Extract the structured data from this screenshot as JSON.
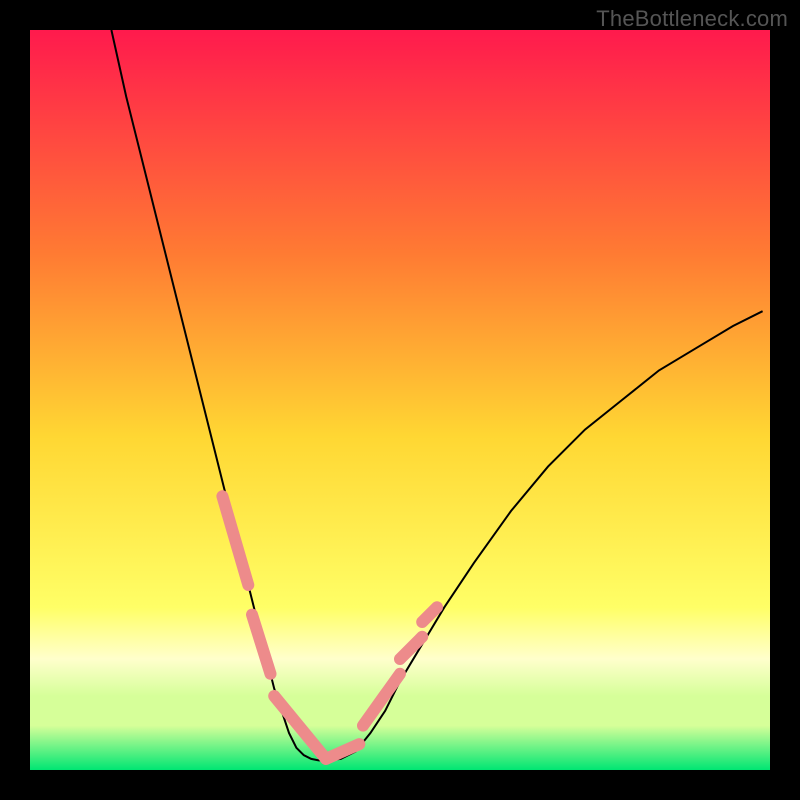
{
  "watermark": "TheBottleneck.com",
  "colors": {
    "bg": "#000000",
    "grad_top": "#ff1a4d",
    "grad_mid_upper": "#ff7a33",
    "grad_mid": "#ffd733",
    "grad_mid_lower": "#ffff66",
    "grad_lower_pale": "#ffffcc",
    "grad_band": "#d6ff99",
    "grad_bottom": "#00e673",
    "curve": "#000000",
    "marker": "#ed8b8b"
  },
  "chart_data": {
    "type": "line",
    "title": "",
    "xlabel": "",
    "ylabel": "",
    "xlim": [
      0,
      100
    ],
    "ylim": [
      0,
      100
    ],
    "curve": {
      "name": "bottleneck-curve",
      "x": [
        11,
        13,
        15,
        17,
        19,
        21,
        23,
        25,
        27,
        29,
        30,
        31,
        32,
        33,
        34,
        35,
        36,
        37,
        38,
        39,
        40,
        42,
        44,
        46,
        48,
        50,
        53,
        56,
        60,
        65,
        70,
        75,
        80,
        85,
        90,
        95,
        99
      ],
      "y": [
        100,
        91,
        83,
        75,
        67,
        59,
        51,
        43,
        35,
        27,
        23,
        19,
        15,
        11,
        8,
        5,
        3,
        2,
        1.5,
        1.3,
        1.3,
        1.5,
        2.5,
        5,
        8,
        12,
        17,
        22,
        28,
        35,
        41,
        46,
        50,
        54,
        57,
        60,
        62
      ]
    },
    "highlight_segments": [
      {
        "x": [
          26,
          29.5
        ],
        "y": [
          37,
          25
        ]
      },
      {
        "x": [
          30,
          32.5
        ],
        "y": [
          21,
          13
        ]
      },
      {
        "x": [
          33,
          40
        ],
        "y": [
          10,
          1.5
        ]
      },
      {
        "x": [
          40,
          44.5
        ],
        "y": [
          1.5,
          3.5
        ]
      },
      {
        "x": [
          45,
          50
        ],
        "y": [
          6,
          13
        ]
      },
      {
        "x": [
          50,
          53
        ],
        "y": [
          15,
          18
        ]
      },
      {
        "x": [
          53,
          55
        ],
        "y": [
          20,
          22
        ]
      }
    ],
    "gradient_bands": [
      {
        "y0": 100,
        "y1": 20,
        "desc": "main rainbow"
      },
      {
        "y0": 20,
        "y1": 10,
        "desc": "pale yellow"
      },
      {
        "y0": 10,
        "y1": 5,
        "desc": "yellow-green band"
      },
      {
        "y0": 5,
        "y1": 0,
        "desc": "green"
      }
    ]
  }
}
